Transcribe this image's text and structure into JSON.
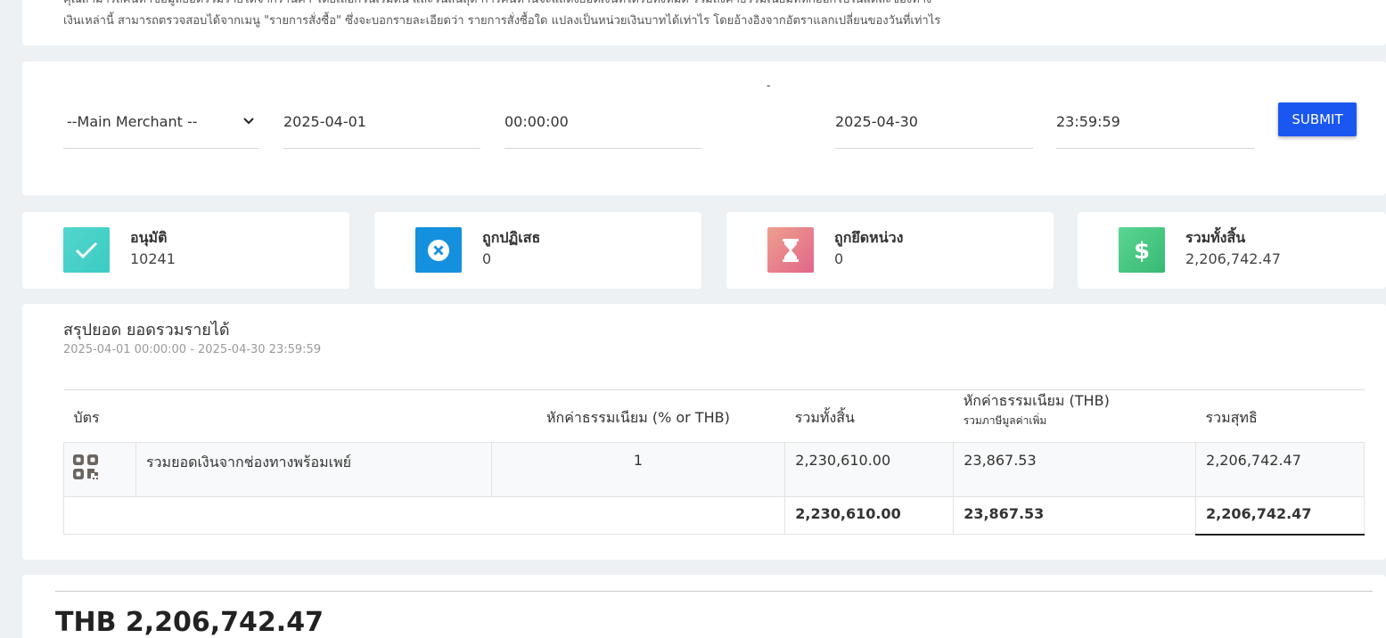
{
  "notice": {
    "line1": "คุณสามารถค้นหาข้อมูลยอดรวมรายได้จากร้านค้า โดยเลือกวันเริ่มต้น และวันสิ้นสุด การค้นหานี้จะแสดงยอดเงินที่ได้รับทั้งหมด รวมถึงค่าธรรมเนียมที่หักออกไปในแต่ละช่องทาง",
    "line2": "เงินเหล่านี้ สามารถตรวจสอบได้จากเมนู \"รายการสั่งซื้อ\" ซึ่งจะบอกรายละเอียดว่า รายการสั่งซื้อใด แปลงเป็นหน่วยเงินบาทได้เท่าไร โดยอ้างอิงจากอัตราแลกเปลี่ยนของวันที่เท่าไร"
  },
  "filters": {
    "separator": "-",
    "merchant": "--Main Merchant --",
    "start_date": "2025-04-01",
    "start_time": "00:00:00",
    "end_date": "2025-04-30",
    "end_time": "23:59:59",
    "submit_label": "SUBMIT"
  },
  "stats": {
    "approved": {
      "label": "อนุมัติ",
      "value": "10241",
      "icon": "check-icon",
      "color": "#44cfc7"
    },
    "rejected": {
      "label": "ถูกปฏิเสธ",
      "value": "0",
      "icon": "x-circle-icon",
      "color": "#1590de"
    },
    "held": {
      "label": "ถูกยึดหน่วง",
      "value": "0",
      "icon": "hourglass-icon",
      "color": "#e77a8a"
    },
    "total": {
      "label": "รวมทั้งสิ้น",
      "value": "2,206,742.47",
      "icon": "dollar-icon",
      "color": "#46c67f"
    }
  },
  "summary": {
    "title": "สรุปยอด ยอดรวมรายได้",
    "range": "2025-04-01 00:00:00 - 2025-04-30 23:59:59",
    "columns": {
      "card": "บัตร",
      "fee_pct": "หักค่าธรรมเนียม (% or THB)",
      "gross": "รวมทั้งสิ้น",
      "fee_thb": "หักค่าธรรมเนียม (THB)",
      "fee_thb_sub": "รวมภาษีมูลค่าเพิ่ม",
      "net": "รวมสุทธิ"
    },
    "rows": [
      {
        "icon": "qr-code-icon",
        "channel": "รวมยอดเงินจากช่องทางพร้อมเพย์",
        "fee_pct": "1",
        "gross": "2,230,610.00",
        "fee_thb": "23,867.53",
        "net": "2,206,742.47"
      }
    ],
    "totals": {
      "gross": "2,230,610.00",
      "fee_thb": "23,867.53",
      "net": "2,206,742.47"
    }
  },
  "bottom": {
    "total": "THB 2,206,742.47"
  }
}
